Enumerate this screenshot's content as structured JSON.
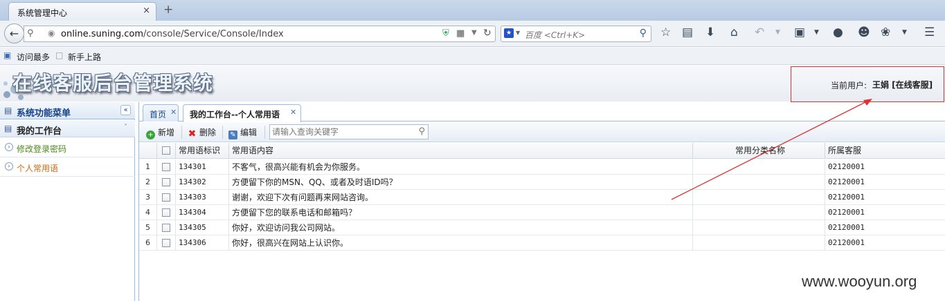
{
  "browser": {
    "tab_title": "系统管理中心",
    "tab_close": "×",
    "new_tab": "+",
    "url_domain": "online.suning.com",
    "url_path": "/console/Service/Console/Index",
    "search_placeholder": "百度 <Ctrl+K>",
    "bookmarks": [
      "访问最多",
      "新手上路"
    ]
  },
  "app": {
    "title": "在线客服后台管理系统",
    "current_user_label": "当前用户:",
    "current_user_name": "王娟 [在线客服]"
  },
  "sidebar": {
    "header": "系统功能菜单",
    "group": "我的工作台",
    "items": [
      {
        "label": "修改登录密码",
        "color": "#4a8a1c"
      },
      {
        "label": "个人常用语",
        "color": "#c86a10"
      }
    ]
  },
  "content": {
    "tabs": [
      {
        "label": "首页"
      },
      {
        "label": "我的工作台--个人常用语"
      }
    ],
    "toolbar": {
      "add": "新增",
      "delete": "删除",
      "edit": "编辑",
      "search_placeholder": "请输入查询关键字"
    },
    "grid": {
      "columns": [
        "常用语标识",
        "常用语内容",
        "常用分类名称",
        "所属客服"
      ],
      "rows": [
        {
          "num": "1",
          "id": "134301",
          "content": "不客气，很高兴能有机会为你服务。",
          "category": "",
          "agent": "02120001"
        },
        {
          "num": "2",
          "id": "134302",
          "content": "方便留下你的MSN、QQ、或者及时语ID吗？",
          "category": "",
          "agent": "02120001"
        },
        {
          "num": "3",
          "id": "134303",
          "content": "谢谢，欢迎下次有问题再来网站咨询。",
          "category": "",
          "agent": "02120001"
        },
        {
          "num": "4",
          "id": "134304",
          "content": "方便留下您的联系电话和邮箱吗？",
          "category": "",
          "agent": "02120001"
        },
        {
          "num": "5",
          "id": "134305",
          "content": "你好，欢迎访问我公司网站。",
          "category": "",
          "agent": "02120001"
        },
        {
          "num": "6",
          "id": "134306",
          "content": "你好，很高兴在网站上认识你。",
          "category": "",
          "agent": "02120001"
        }
      ]
    }
  },
  "watermark": "www.wooyun.org",
  "colors": {
    "accent": "#15428b",
    "annotation": "#dd3333"
  }
}
